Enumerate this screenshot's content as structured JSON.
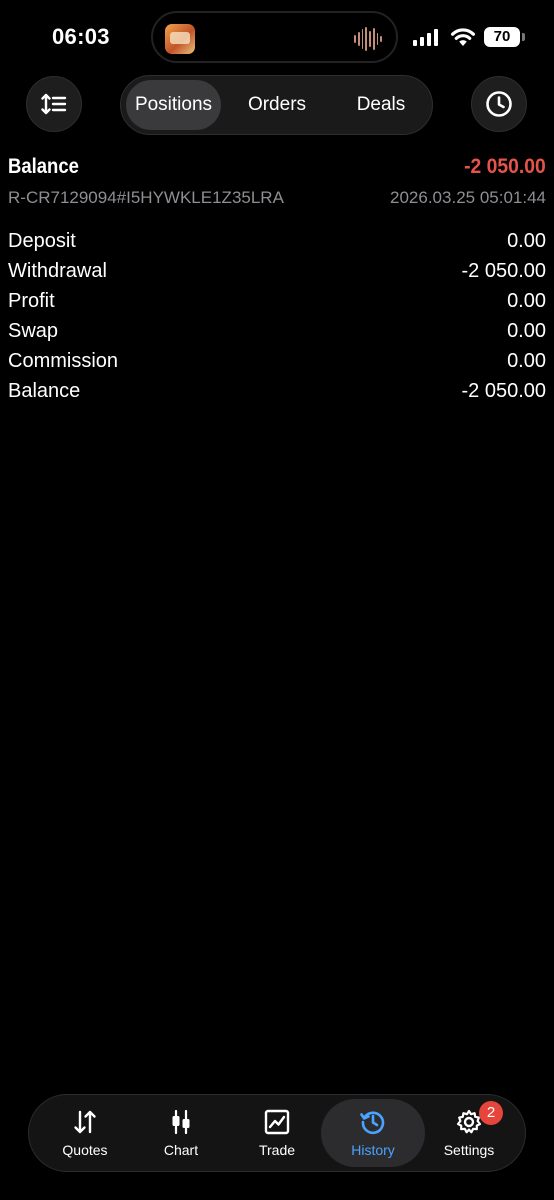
{
  "status_bar": {
    "time": "06:03",
    "battery": "70",
    "live_activity_icon": "app-thumbnail-icon",
    "audio_icon": "audio-waveform-icon"
  },
  "toolbar": {
    "sort_icon": "sort-icon",
    "history_icon": "clock-icon",
    "tabs": [
      {
        "label": "Positions",
        "active": true
      },
      {
        "label": "Orders",
        "active": false
      },
      {
        "label": "Deals",
        "active": false
      }
    ]
  },
  "balance": {
    "title": "Balance",
    "amount": "-2 050.00",
    "amount_color": "#e5534b",
    "id": "R-CR7129094#I5HYWKLE1Z35LRA",
    "timestamp": "2026.03.25 05:01:44"
  },
  "details": [
    {
      "label": "Deposit",
      "value": "0.00"
    },
    {
      "label": "Withdrawal",
      "value": "-2 050.00"
    },
    {
      "label": "Profit",
      "value": "0.00"
    },
    {
      "label": "Swap",
      "value": "0.00"
    },
    {
      "label": "Commission",
      "value": "0.00"
    },
    {
      "label": "Balance",
      "value": "-2 050.00"
    }
  ],
  "tab_bar": {
    "accent_color": "#4aa3ff",
    "items": [
      {
        "label": "Quotes",
        "icon": "arrows-up-down-icon"
      },
      {
        "label": "Chart",
        "icon": "candlestick-icon"
      },
      {
        "label": "Trade",
        "icon": "trend-chart-icon"
      },
      {
        "label": "History",
        "icon": "history-clock-icon",
        "active": true
      },
      {
        "label": "Settings",
        "icon": "gear-icon",
        "badge": "2"
      }
    ]
  }
}
